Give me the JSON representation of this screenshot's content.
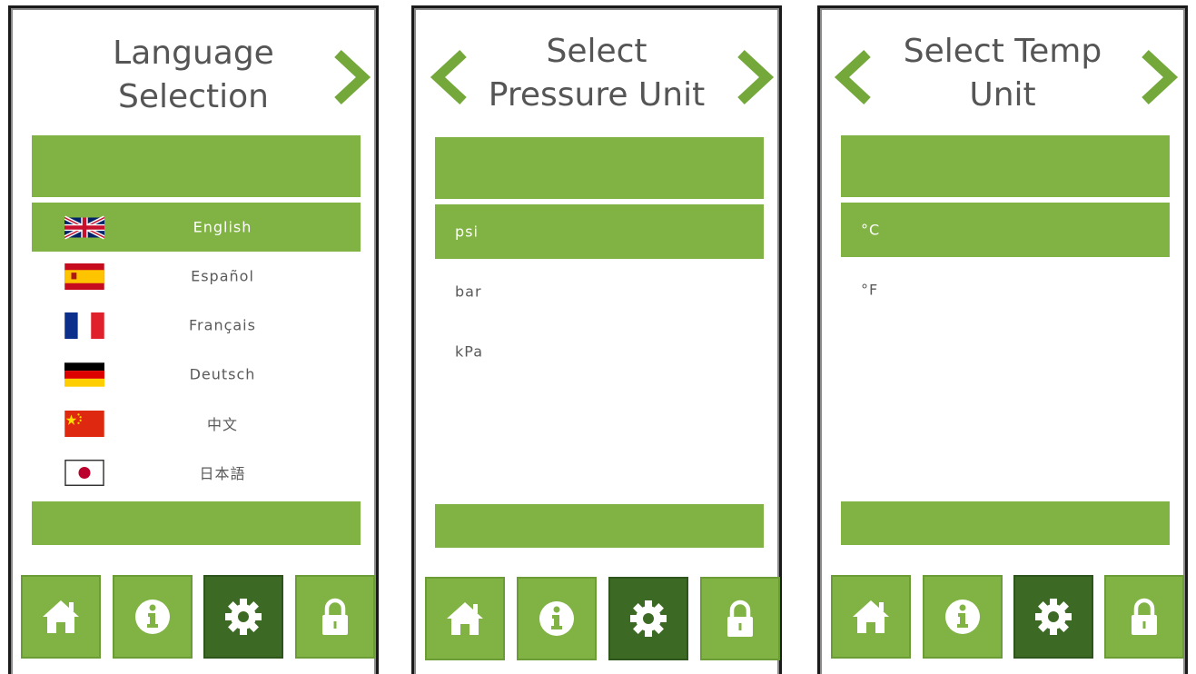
{
  "colors": {
    "accent": "#80b343",
    "active": "#3c6a24",
    "text": "#555555",
    "arrow": "#74a83a"
  },
  "panels": [
    {
      "title_lines": [
        "Language",
        "Selection"
      ],
      "items": [
        {
          "label": "English",
          "flag": "uk-flag-icon",
          "selected": true
        },
        {
          "label": "Español",
          "flag": "spain-flag-icon",
          "selected": false
        },
        {
          "label": "Français",
          "flag": "france-flag-icon",
          "selected": false
        },
        {
          "label": "Deutsch",
          "flag": "germany-flag-icon",
          "selected": false
        },
        {
          "label": "中文",
          "flag": "china-flag-icon",
          "selected": false
        },
        {
          "label": "日本語",
          "flag": "japan-flag-icon",
          "selected": false
        }
      ]
    },
    {
      "title_lines": [
        "Select",
        "Pressure Unit"
      ],
      "items": [
        {
          "label": "psi",
          "selected": true
        },
        {
          "label": "bar",
          "selected": false
        },
        {
          "label": "kPa",
          "selected": false
        }
      ]
    },
    {
      "title_lines": [
        "Select Temp",
        "Unit"
      ],
      "items": [
        {
          "label": "°C",
          "selected": true
        },
        {
          "label": "°F",
          "selected": false
        }
      ]
    }
  ],
  "toolbar": [
    {
      "icon": "home-icon",
      "active": false
    },
    {
      "icon": "info-icon",
      "active": false
    },
    {
      "icon": "gear-icon",
      "active": true
    },
    {
      "icon": "lock-icon",
      "active": false
    }
  ]
}
